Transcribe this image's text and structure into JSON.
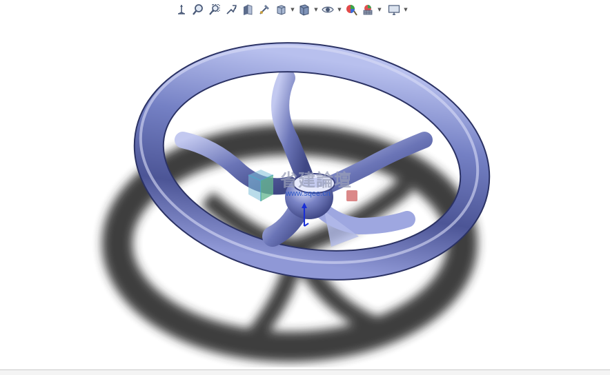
{
  "toolbar": {
    "buttons": [
      {
        "name": "view-orientation-icon",
        "dropdown": false
      },
      {
        "name": "zoom-to-fit-icon",
        "dropdown": false
      },
      {
        "name": "zoom-to-area-icon",
        "dropdown": false
      },
      {
        "name": "previous-view-icon",
        "dropdown": false
      },
      {
        "name": "section-view-icon",
        "dropdown": false
      },
      {
        "name": "dynamic-annotation-icon",
        "dropdown": false
      },
      {
        "name": "view-orientation-cube-icon",
        "dropdown": true
      },
      {
        "name": "display-style-icon",
        "dropdown": true
      },
      {
        "name": "hide-show-items-icon",
        "dropdown": true
      },
      {
        "name": "edit-appearance-icon",
        "dropdown": false
      },
      {
        "name": "apply-scene-icon",
        "dropdown": true
      },
      {
        "name": "view-settings-icon",
        "dropdown": true
      }
    ]
  },
  "watermark": {
    "title": "省建論壇",
    "url": "www.sqee.cn"
  },
  "colors": {
    "part_body": "#6a74b8",
    "part_highlight": "#c9cff2",
    "shadow": "#3a3a3a",
    "triad_axis": "#1a2fd6"
  }
}
